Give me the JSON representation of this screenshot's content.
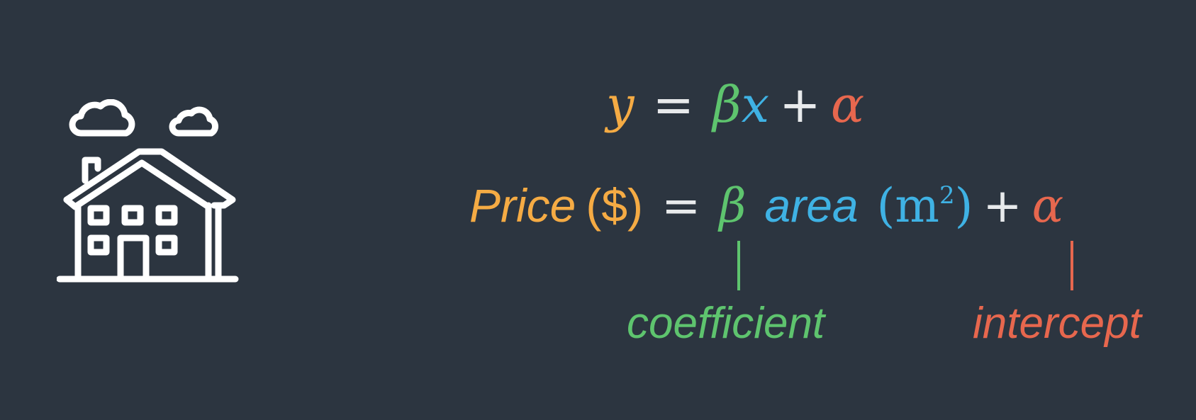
{
  "equation_general": {
    "y": "y",
    "equals": "=",
    "beta": "β",
    "x": "x",
    "plus": "+",
    "alpha": "α"
  },
  "equation_price": {
    "price": "Price",
    "currency": "($)",
    "equals": "=",
    "beta": "β",
    "area": "area",
    "unit_open": "(m",
    "unit_power": "2",
    "unit_close": ")",
    "plus": "+",
    "alpha": "α"
  },
  "annotations": {
    "coefficient": "coefficient",
    "intercept": "intercept"
  },
  "colors": {
    "background": "#2c3540",
    "dependent": "#f5ab44",
    "coefficient": "#5ec46e",
    "variable": "#3fb2e4",
    "intercept": "#e7674e",
    "operator": "#e8eaec",
    "icon": "#ffffff"
  },
  "icons": {
    "house": "house-with-clouds-icon"
  }
}
